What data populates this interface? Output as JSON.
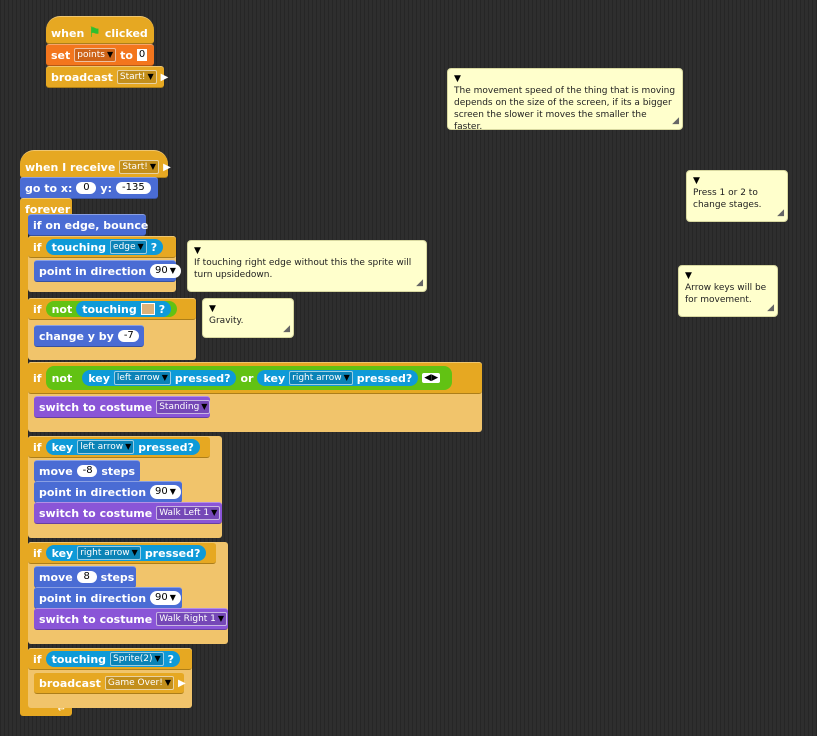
{
  "scripts": {
    "when_clicked": {
      "when": "when",
      "clicked": "clicked",
      "set": "set",
      "var": "points",
      "to": "to",
      "value": "0",
      "broadcast": "broadcast",
      "msg": "Start!"
    },
    "receive": {
      "hat": "when I receive",
      "msg": "Start!"
    },
    "goto": {
      "label": "go to x:",
      "x": "0",
      "ylabel": "y:",
      "y": "-135"
    },
    "forever": "forever",
    "bounce": "if on edge, bounce",
    "if": "if",
    "touching": "touching",
    "edge": "edge",
    "q": "?",
    "point_dir": "point in direction",
    "dir90": "90",
    "not": "not",
    "change_y": "change y by",
    "change_val": "-7",
    "key": "key",
    "pressed": "pressed?",
    "or": "or",
    "left_arrow": "left arrow",
    "right_arrow": "right arrow",
    "switch_costume": "switch to costume",
    "standing": "Standing",
    "move": "move",
    "steps": "steps",
    "move_left": "-8",
    "move_right": "8",
    "walk_left": "Walk Left 1",
    "walk_right": "Walk Right 1",
    "sprite2": "Sprite(2)",
    "broadcast": "broadcast",
    "game_over": "Game Over!"
  },
  "notes": {
    "speed": "The movement speed of the thing that is moving depends on the size of the screen, if its a bigger screen the slower it moves the smaller the faster.",
    "stages": "Press 1 or 2  to change stages.",
    "arrows": "Arrow keys will be for movement.",
    "edge": "If touching right edge without this the sprite will turn upsidedown.",
    "gravity": "Gravity."
  }
}
